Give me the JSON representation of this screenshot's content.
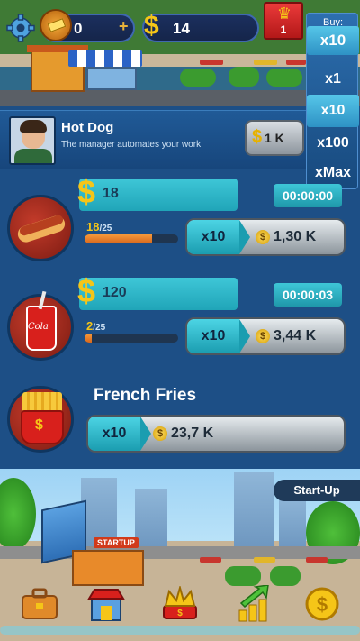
{
  "hud": {
    "gold_value": "0",
    "gold_plus": "+",
    "cash_symbol": "$",
    "cash_value": "14",
    "crown_badge": "1"
  },
  "buy_panel": {
    "title": "Buy:",
    "options": [
      "x10",
      "x1",
      "x10",
      "x100",
      "xMax"
    ],
    "selected_index": 0
  },
  "manager": {
    "name": "Hot Dog",
    "description": "The manager automates your work",
    "price": "1 K",
    "currency_symbol": "$"
  },
  "businesses": [
    {
      "name": "Hot Dog",
      "income": "18",
      "owned": "18",
      "owned_max": "/25",
      "progress": 0.72,
      "timer": "00:00:00",
      "multiplier": "x10",
      "price": "1,30 K"
    },
    {
      "name": "Cola",
      "income": "120",
      "owned": "2",
      "owned_max": "/25",
      "progress": 0.08,
      "timer": "00:00:03",
      "multiplier": "x10",
      "price": "3,44 K"
    },
    {
      "name": "French Fries",
      "multiplier": "x10",
      "price": "23,7 K"
    }
  ],
  "city": {
    "startup_sign": "STARTUP",
    "area_button": "Start-Up"
  },
  "nav": [
    "briefcase-icon",
    "shop-icon",
    "crown-money-icon",
    "growth-arrow-icon",
    "dollar-coin-icon"
  ],
  "colors": {
    "teal": "#3ec6d7",
    "panel_blue": "#1d4f86",
    "orange_progress": "#f59a3a",
    "gold": "#f5c518",
    "red_badge": "#d32424"
  }
}
